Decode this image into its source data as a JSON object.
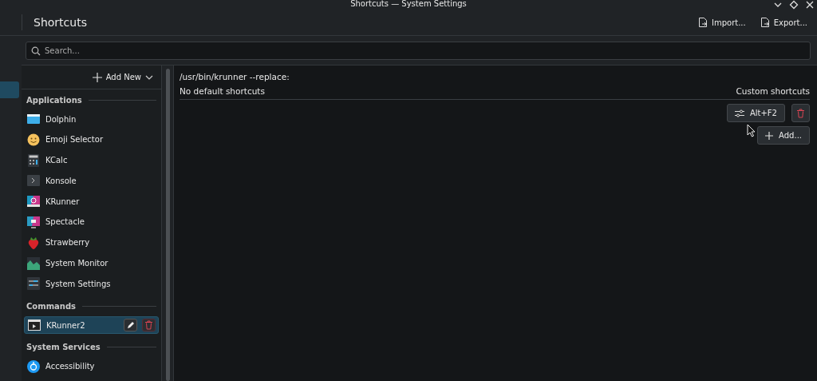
{
  "window": {
    "title": "Shortcuts — System Settings"
  },
  "header": {
    "title": "Shortcuts",
    "actions": [
      {
        "label": "Import..."
      },
      {
        "label": "Export..."
      }
    ]
  },
  "sidebar": {
    "items": [
      {
        "selected": true
      }
    ]
  },
  "search": {
    "placeholder": "Search..."
  },
  "list": {
    "add_new": "Add New",
    "groups": [
      {
        "title": "Applications",
        "items": [
          {
            "label": "Dolphin",
            "selected": false
          },
          {
            "label": "Emoji Selector",
            "selected": false
          },
          {
            "label": "KCalc",
            "selected": false
          },
          {
            "label": "Konsole",
            "selected": false
          },
          {
            "label": "KRunner",
            "selected": false
          },
          {
            "label": "Spectacle",
            "selected": false
          },
          {
            "label": "Strawberry",
            "selected": false
          },
          {
            "label": "System Monitor",
            "selected": false
          },
          {
            "label": "System Settings",
            "selected": false
          }
        ]
      },
      {
        "title": "Commands",
        "items": [
          {
            "label": "KRunner2",
            "selected": true
          }
        ]
      },
      {
        "title": "System Services",
        "items": [
          {
            "label": "Accessibility",
            "selected": false
          }
        ]
      }
    ]
  },
  "detail": {
    "command": "/usr/bin/krunner --replace:",
    "default_shortcuts": "No default shortcuts",
    "custom_heading": "Custom shortcuts",
    "custom_shortcuts": [
      {
        "keys": "Alt+F2"
      }
    ],
    "add_button": "Add..."
  }
}
